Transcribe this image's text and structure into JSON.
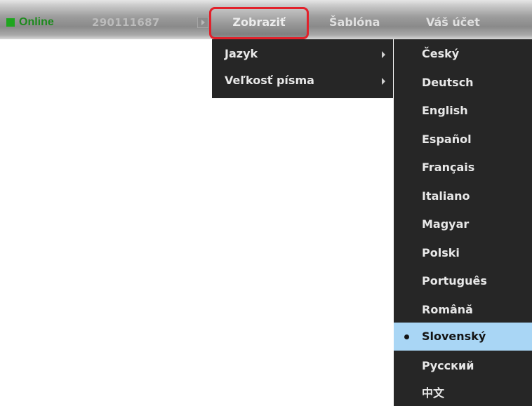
{
  "topbar": {
    "status_label": "Online",
    "user_id": "290111687",
    "menus": {
      "view": "Zobraziť",
      "template": "Šablóna",
      "account": "Váš účet"
    },
    "colors": {
      "status": "#1fa51f",
      "highlight": "#e2202a"
    }
  },
  "view_menu": {
    "items": [
      {
        "label": "Jazyk"
      },
      {
        "label": "Veľkosť písma"
      }
    ]
  },
  "language_menu": {
    "selected": "Slovenský",
    "selected_color": "#a9d6f5",
    "items": [
      {
        "label": "Český"
      },
      {
        "label": "Deutsch"
      },
      {
        "label": "English"
      },
      {
        "label": "Español"
      },
      {
        "label": "Français"
      },
      {
        "label": "Italiano"
      },
      {
        "label": "Magyar"
      },
      {
        "label": "Polski"
      },
      {
        "label": "Português"
      },
      {
        "label": "Română"
      },
      {
        "label": "Slovenský"
      },
      {
        "label": "Русский"
      },
      {
        "label": "中文"
      }
    ]
  }
}
